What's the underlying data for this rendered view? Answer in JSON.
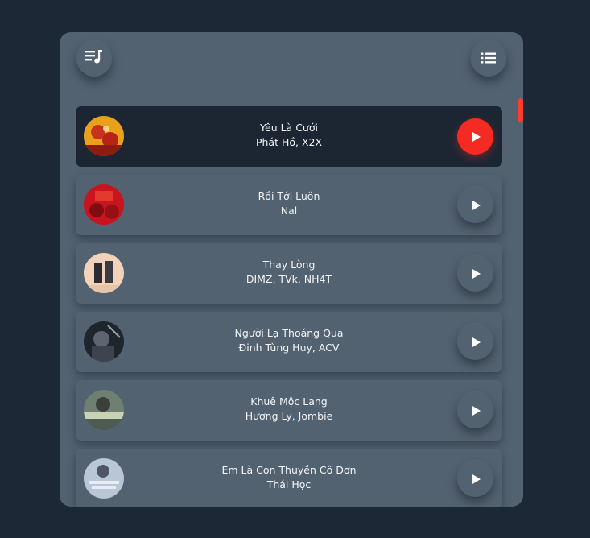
{
  "header": {
    "left_icon": "music-playlist-icon",
    "right_icon": "list-icon"
  },
  "accent_color": "#f52a22",
  "songs": [
    {
      "title": "Yêu Là Cưới",
      "artist": "Phát Hồ, X2X",
      "active": true
    },
    {
      "title": "Rồi Tới Luôn",
      "artist": "Nal",
      "active": false
    },
    {
      "title": "Thay Lòng",
      "artist": "DIMZ, TVk, NH4T",
      "active": false
    },
    {
      "title": "Người Lạ Thoáng Qua",
      "artist": "Đinh Tùng Huy, ACV",
      "active": false
    },
    {
      "title": "Khuê Mộc Lang",
      "artist": "Hương Ly, Jombie",
      "active": false
    },
    {
      "title": "Em Là Con Thuyền Cô Đơn",
      "artist": "Thái Học",
      "active": false
    }
  ]
}
